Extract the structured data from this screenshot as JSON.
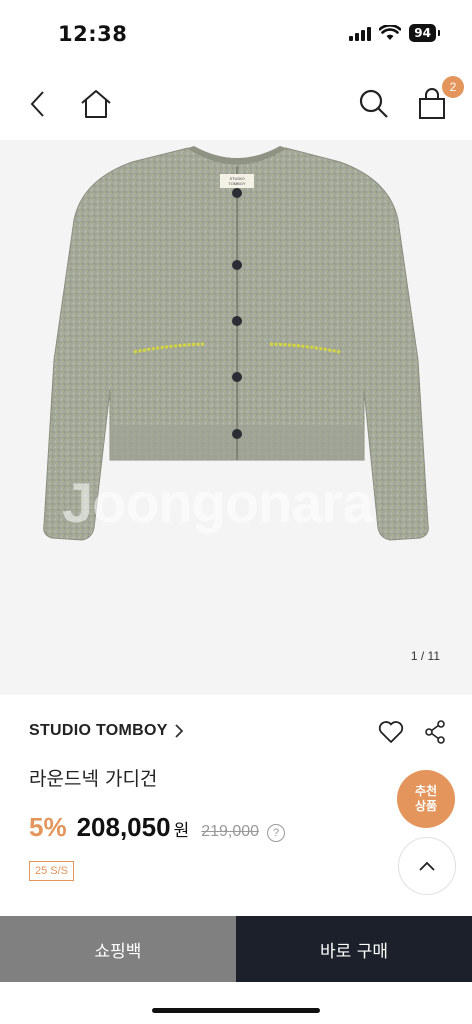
{
  "status_bar": {
    "time": "12:38",
    "battery": "94"
  },
  "nav": {
    "cart_count": "2"
  },
  "image": {
    "counter": "1 / 11",
    "watermark": "Joongonara",
    "label_text": "STUDIO\nTOMBOY"
  },
  "product": {
    "brand": "STUDIO TOMBOY",
    "title": "라운드넥 가디건",
    "discount": "5%",
    "price": "208,050",
    "currency": "원",
    "original_price": "219,000",
    "season_badge": "25 S/S"
  },
  "floating": {
    "recommend_label": "추천\n상품"
  },
  "bottom_bar": {
    "cart_label": "쇼핑백",
    "buy_label": "바로 구매"
  },
  "colors": {
    "accent": "#e3955b",
    "buy_button": "#1b202a",
    "cart_button": "#808080"
  }
}
